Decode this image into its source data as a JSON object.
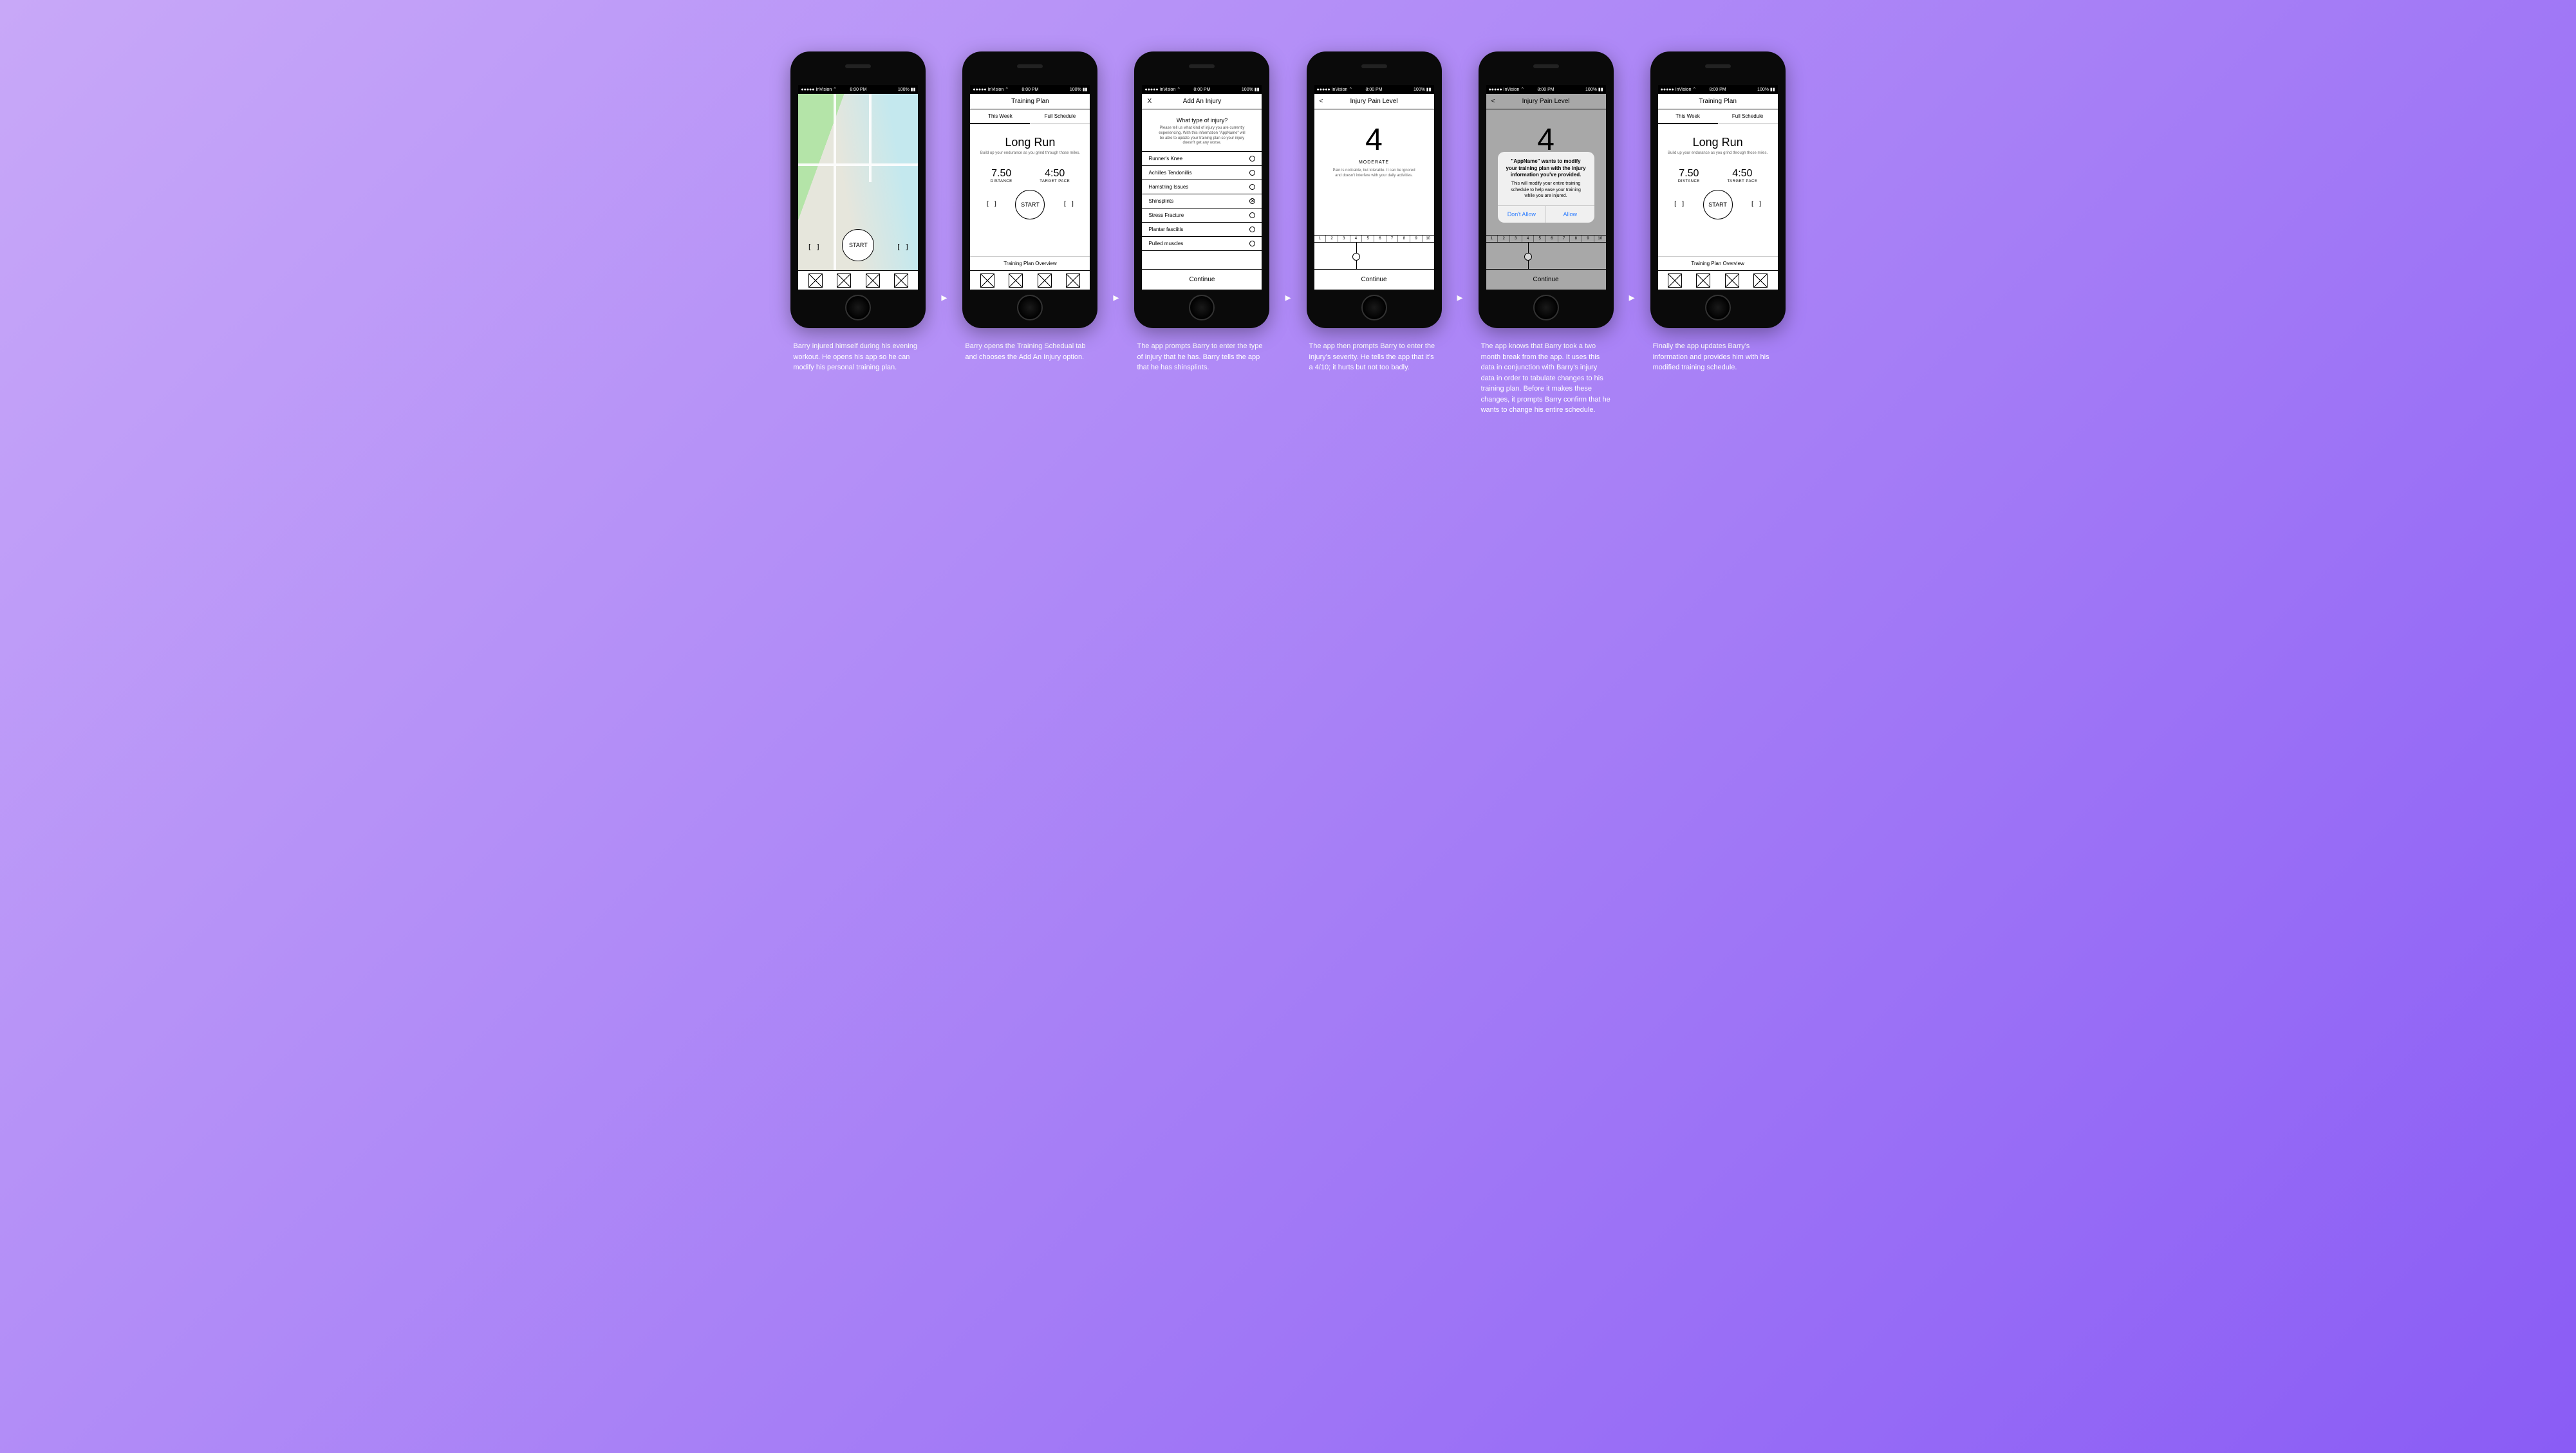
{
  "status": {
    "left": "●●●●● InVision ⌃",
    "time": "8:00 PM",
    "right": "100% ▮▮"
  },
  "captions": [
    "Barry injured himself during his evening workout. He opens his app so he can modify his personal training plan.",
    "Barry opens the Training Schedual tab and chooses the Add An Injury option.",
    "The app prompts Barry to enter the type of injury that he has. Barry tells the app that he has shinsplints.",
    "The app then prompts Barry to enter the injury's severity. He tells the app that it's a 4/10; it hurts but not too badly.",
    "The app knows that Barry took a two month break from the app. It uses this data in conjunction with Barry's injury data in order to tabulate changes to his training plan. Before it makes these changes, it prompts Barry confirm that he wants to change his entire schedule.",
    "Finally the app updates Barry's information and provides him with his modified training schedule."
  ],
  "map": {
    "start": "START",
    "brL": "[  ]",
    "brR": "[  ]"
  },
  "plan": {
    "title": "Training Plan",
    "tabs": [
      "This Week",
      "Full Schedule"
    ],
    "workout": "Long Run",
    "sub": "Build up your endurance as you grind through those miles.",
    "distance_v": "7.50",
    "distance_l": "DISTANCE",
    "pace_v": "4:50",
    "pace_l": "TARGET PACE",
    "start": "START",
    "brL": "[  ]",
    "brR": "[  ]",
    "overview": "Training Plan Overview"
  },
  "injury": {
    "title": "Add An Injury",
    "close": "X",
    "q_title": "What type of injury?",
    "q_body": "Please tell us what kind of injury you are currently experiencing. With this information \"AppName\" will be able to update your training plan so your injury doesn't get any worse.",
    "items": [
      {
        "label": "Runner's Knee",
        "sel": false
      },
      {
        "label": "Achilles Tendonillis",
        "sel": false
      },
      {
        "label": "Hamstring Issues",
        "sel": false
      },
      {
        "label": "Shinsplints",
        "sel": true
      },
      {
        "label": "Stress Fracture",
        "sel": false
      },
      {
        "label": "Plantar fasciitis",
        "sel": false
      },
      {
        "label": "Pulled muscles",
        "sel": false
      }
    ],
    "continue": "Continue"
  },
  "pain": {
    "title": "Injury Pain Level",
    "back": "<",
    "num": "4",
    "label": "MODERATE",
    "desc": "Pain is noticable, but tolerable. It can be ignored and doesn't interfere with your daily activities.",
    "ticks": [
      "1",
      "2",
      "3",
      "4",
      "5",
      "6",
      "7",
      "8",
      "9",
      "10"
    ],
    "continue": "Continue"
  },
  "alert": {
    "title": "\"AppName\" wants to modify your training plan with the injury information you've provided.",
    "body": "This will modify your entire training schedule to help ease your training while you are injured.",
    "deny": "Don't Allow",
    "allow": "Allow"
  }
}
